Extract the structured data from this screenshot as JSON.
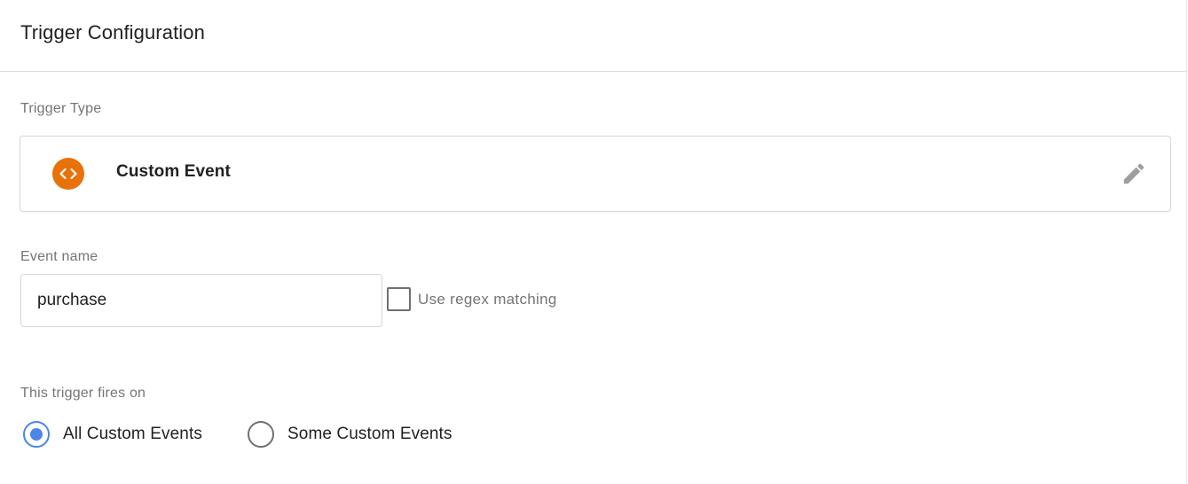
{
  "header": {
    "title": "Trigger Configuration"
  },
  "trigger_type": {
    "label": "Trigger Type",
    "name": "Custom Event",
    "icon": "code-brackets-icon",
    "icon_color": "#e8710a",
    "edit_icon": "pencil-icon"
  },
  "event_name": {
    "label": "Event name",
    "value": "purchase",
    "regex_checkbox": {
      "label": "Use regex matching",
      "checked": false
    }
  },
  "fires_on": {
    "label": "This trigger fires on",
    "options": [
      {
        "label": "All Custom Events",
        "selected": true
      },
      {
        "label": "Some Custom Events",
        "selected": false
      }
    ],
    "accent_color": "#4a86e8"
  }
}
